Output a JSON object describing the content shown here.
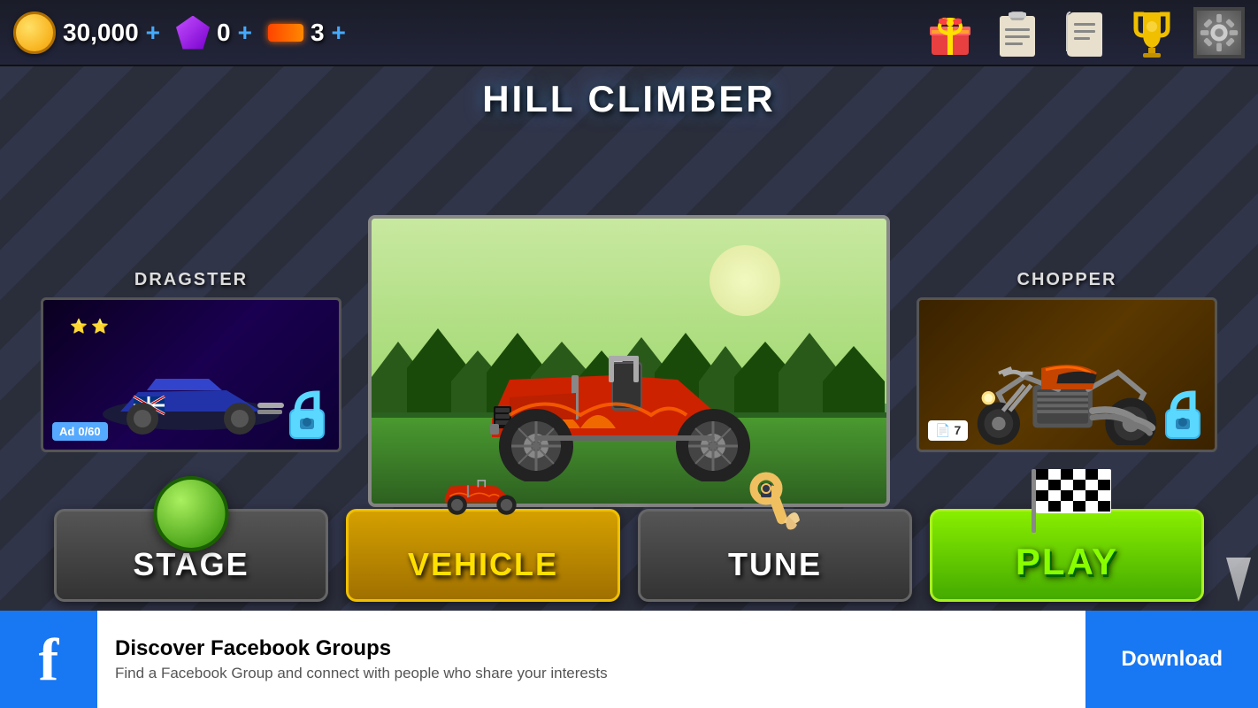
{
  "header": {
    "coins": "30,000",
    "gems": "0",
    "boosts": "3",
    "title": "HILL CLIMBER"
  },
  "vehicles": {
    "left": {
      "name": "DRAGSTER",
      "ad_label": "Ad",
      "progress": "0/60"
    },
    "center": {
      "name": "HILL CLIMBER"
    },
    "right": {
      "name": "CHOPPER",
      "badge_num": "7"
    }
  },
  "buttons": {
    "stage": "STAGE",
    "vehicle": "VEHICLE",
    "tune": "TUNE",
    "play": "PLAY"
  },
  "ad": {
    "title": "Discover Facebook Groups",
    "subtitle": "Find a Facebook Group and connect with people who share your interests",
    "cta": "Download"
  },
  "icons": {
    "gift": "🎁",
    "clipboard": "📋",
    "scroll": "📜",
    "trophy": "🏆",
    "gear": "⚙️",
    "plus": "+",
    "lock": "🔒",
    "wrench": "🔧",
    "checkerflag": "🏁"
  }
}
